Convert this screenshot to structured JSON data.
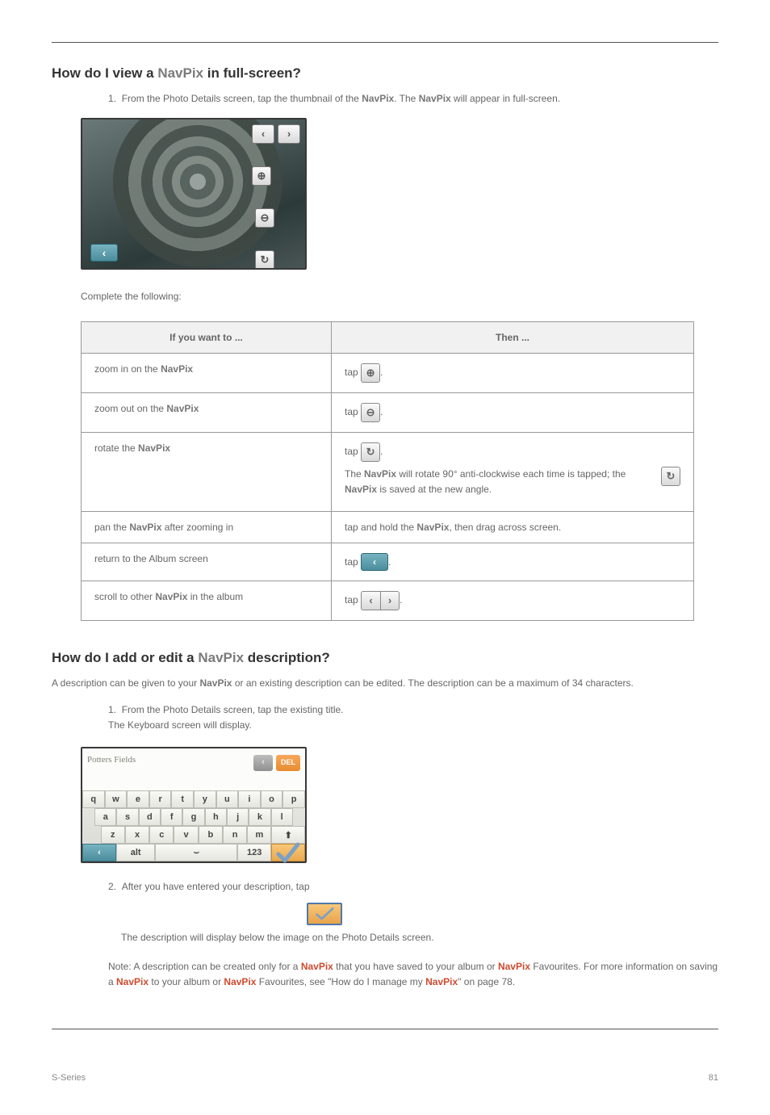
{
  "brand": "NavPix",
  "h1": {
    "pre": "How do I view a ",
    "post": " in full-screen?"
  },
  "s1": {
    "p1a": "From the Photo Details screen, tap the thumbnail of the ",
    "p1b": ". The ",
    "p1c": " will appear in full-screen.",
    "num": "1."
  },
  "table": {
    "th1": "If you want to ...",
    "th2": "Then ...",
    "rows": [
      {
        "a1": "zoom in on the ",
        "a2": "",
        "b1": "tap ",
        "b2": "."
      },
      {
        "a1": "zoom out on the ",
        "a2": "",
        "b1": "tap ",
        "b2": "."
      },
      {
        "a1": "rotate the ",
        "a2": "",
        "b1": "tap ",
        "b2": ".",
        "nb1": "The ",
        "nb2": " will rotate 90° anti-clockwise each time ",
        "nb3": " is tapped; the ",
        "nb4": " is saved at the new angle."
      },
      {
        "a1": "pan the ",
        "a2": " after zooming in",
        "b1": "tap and hold the ",
        "b2": ", then drag across screen."
      },
      {
        "a1": "return to the Album screen",
        "b1": "tap ",
        "b2": "."
      },
      {
        "a1": "scroll to other ",
        "a2": " in the album",
        "b1": "tap ",
        "b2": "."
      }
    ]
  },
  "h2": {
    "pre": "How do I add or edit a ",
    "post": " description?"
  },
  "s2": {
    "intro": "A description can be given to your ",
    "intro2": " or an existing description can be edited. The description can be a maximum of 34 characters.",
    "step1": {
      "n": "1.",
      "t1": "From the Photo Details screen, tap the existing title.",
      "t2": "The Keyboard screen will display."
    },
    "kb_title": "Potters Fields",
    "del": "DEL",
    "rows": [
      [
        "q",
        "w",
        "e",
        "r",
        "t",
        "y",
        "u",
        "i",
        "o",
        "p"
      ],
      [
        "a",
        "s",
        "d",
        "f",
        "g",
        "h",
        "j",
        "k",
        "l"
      ],
      [
        "z",
        "x",
        "c",
        "v",
        "b",
        "n",
        "m",
        "⬆"
      ],
      [
        "‹",
        "alt",
        "⌣",
        "123",
        "✓"
      ]
    ],
    "step2": {
      "n": "2.",
      "t1": "After you have entered your description, tap ",
      "t2": ".",
      "t3": "The description will display below the image on the Photo Details screen."
    },
    "note": {
      "a": "Note: A description can be created only for a ",
      "b": " that you have saved to your album or ",
      "c": " Favourites. For more information on saving a ",
      "d": " to your album or ",
      "e": " Favourites, see \"How do I manage my ",
      "f": "\" on page 78."
    }
  },
  "footer": {
    "left": "S-Series",
    "right": "81"
  }
}
